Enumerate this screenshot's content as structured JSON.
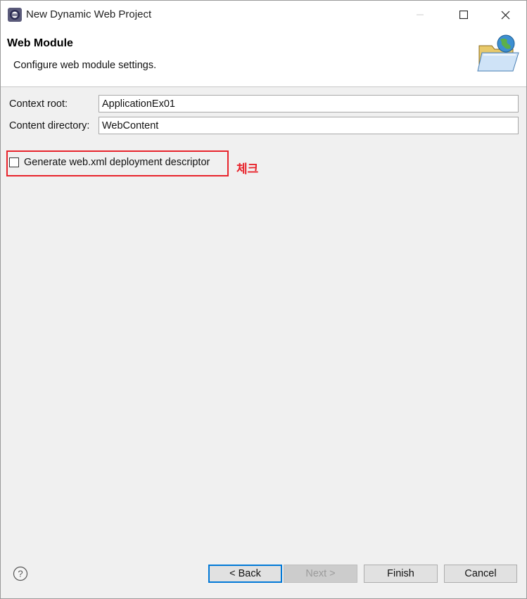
{
  "window": {
    "title": "New Dynamic Web Project",
    "icons": [
      "eclipse-app-icon",
      "minimize-icon",
      "maximize-icon",
      "close-icon"
    ]
  },
  "header": {
    "title": "Web Module",
    "description": "Configure web module settings.",
    "icon": "web-folder-globe-icon"
  },
  "form": {
    "context_root_label": "Context root:",
    "context_root_value": "ApplicationEx01",
    "content_dir_label": "Content directory:",
    "content_dir_value": "WebContent",
    "generate_label": "Generate web.xml deployment descriptor",
    "generate_checked": false
  },
  "annotation": {
    "text": "체크",
    "color": "#e8242c"
  },
  "buttons": {
    "back": "< Back",
    "next": "Next >",
    "finish": "Finish",
    "cancel": "Cancel",
    "next_enabled": false
  },
  "colors": {
    "accent": "#0078d7",
    "highlight": "#e8242c"
  }
}
